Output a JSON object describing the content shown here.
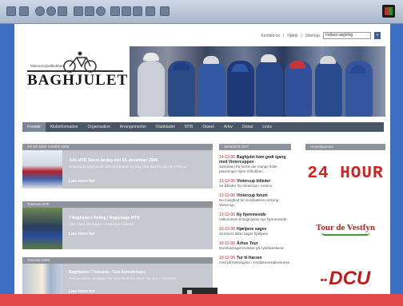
{
  "header": {
    "links": [
      "Kontakt os",
      "Hjælp",
      "Sitemap"
    ],
    "search_value": "Indtast søgning"
  },
  "logo": {
    "small_text": "Motionscykelklubben",
    "name": "BAGHJULET"
  },
  "nav": [
    "Forside",
    "Klubinformation",
    "Organisation",
    "Arrangementer",
    "Klubbladet",
    "MTB",
    "Dianet",
    "Arkiv",
    "Debat",
    "Links"
  ],
  "news": [
    {
      "head": "SÅ ER DER TURER 2006",
      "title": "Julo MTB Swem lørdag den 16. december 2006",
      "text": "Unternig til baghjulets stort af juleturet og hog med Beerlin på jule MTB tur.",
      "more": "Læs mere her"
    },
    {
      "head": "Tokertsa MTB",
      "title": "7 Baghjulers Reflag i Negamøge MTB",
      "text": "Læs mere om dagen i Snæringe tabletue.",
      "more": "Læs mere her"
    },
    {
      "head": "Toscana 2006",
      "title": "Baghjulere i Toscana - Tuls korestenspo",
      "text": "Toscanaturen deltagere har skrevet deres arbeil sin turen i tinosters.",
      "more": "Læs mere her"
    }
  ],
  "latest": {
    "head": "SENESTE NYT",
    "items": [
      {
        "date": "14-12-06",
        "title": "Baghjulet kom godt igang med Vintercuppen",
        "desc": "Søndraen fra herrle der mange flotte placeringer hjem til klubben."
      },
      {
        "date": "13-12-06",
        "title": "Vintercup billeder",
        "desc": "Se billeder fra Vintercup i Assens."
      },
      {
        "date": "13-12-06",
        "title": "Vintercup forum",
        "desc": "Nu mulighed for at debattere omkring Vintercup."
      },
      {
        "date": "13-12-06",
        "title": "Ny hjemmeside",
        "desc": "Velkommen til Baghjulets nye hjemmeside."
      },
      {
        "date": "10-12-06",
        "title": "Hjælpere søges",
        "desc": "24 timers løbet søger hjælpere"
      },
      {
        "date": "10-12-06",
        "title": "Århus Tour",
        "desc": "Eventuldraget invitater på cykelweekend"
      },
      {
        "date": "10-12-06",
        "title": "Tur til Harzen",
        "desc": "med på træningstur i Kreddinnerkalkestorien"
      }
    ]
  },
  "sponsors": {
    "head": "Hovedsponsor",
    "ad1": "24 HOUR",
    "ad2": "Tour de Vestfyn",
    "ad3": "DCU"
  },
  "colors": {
    "nav_bg": "#4a5566",
    "accent_red": "#d32020",
    "box_bg": "#c5c9cf"
  }
}
